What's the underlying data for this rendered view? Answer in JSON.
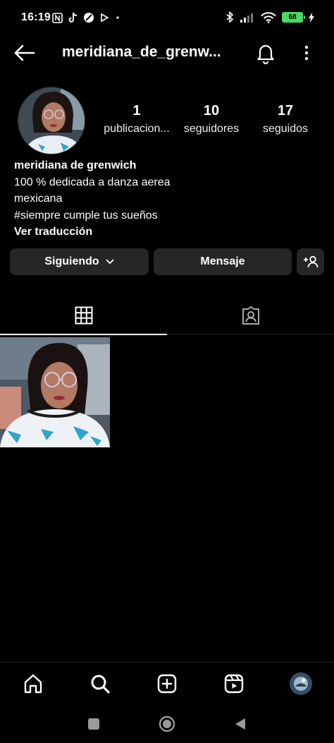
{
  "status_bar": {
    "time": "16:19",
    "battery": "68"
  },
  "header": {
    "username": "meridiana_de_grenw..."
  },
  "profile": {
    "stats": [
      {
        "value": "1",
        "label": "publicacion..."
      },
      {
        "value": "10",
        "label": "seguidores"
      },
      {
        "value": "17",
        "label": "seguidos"
      }
    ],
    "name": "meridiana de grenwich",
    "bio_lines": [
      "100 % dedicada a danza aerea",
      "mexicana",
      "#siempre cumple tus sueños"
    ],
    "translate_link": "Ver traducción"
  },
  "actions": {
    "follow_label": "Siguiendo",
    "message_label": "Mensaje"
  },
  "tabs": [
    {
      "icon": "grid-icon",
      "active": true
    },
    {
      "icon": "tagged-icon",
      "active": false
    }
  ],
  "bottom_nav": [
    "home-icon",
    "search-icon",
    "create-icon",
    "reels-icon",
    "profile-avatar"
  ],
  "colors": {
    "background": "#000000",
    "button_bg": "#262626",
    "battery": "#4cd964"
  }
}
